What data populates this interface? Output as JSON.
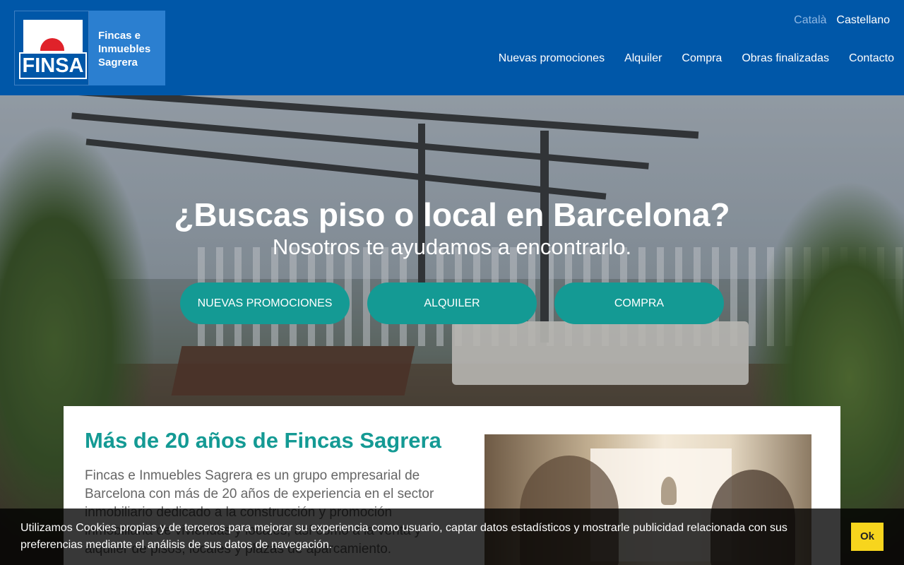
{
  "logo": {
    "mark_text": "FINSA",
    "name_lines": [
      "Fincas e",
      "Inmuebles",
      "Sagrera"
    ]
  },
  "languages": {
    "active": "Català",
    "other": "Castellano"
  },
  "nav": {
    "items": [
      "Nuevas promociones",
      "Alquiler",
      "Compra",
      "Obras finalizadas",
      "Contacto"
    ]
  },
  "hero": {
    "title": "¿Buscas piso o local en Barcelona?",
    "subtitle": "Nosotros te ayudamos a encontrarlo.",
    "buttons": [
      "NUEVAS PROMOCIONES",
      "ALQUILER",
      "COMPRA"
    ]
  },
  "intro": {
    "title": "Más de 20 años de Fincas Sagrera",
    "text": "Fincas e Inmuebles Sagrera es un grupo empresarial de Barcelona con más de 20 años de experiencia en el sector inmobiliario dedicado a la construcción y promoción inmobiliaria de viviendas y locales, así como a la venta y alquiler de pisos, locales y plazas de aparcamiento."
  },
  "cookie": {
    "text": "Utilizamos Cookies propias y de terceros para mejorar su experiencia como usuario, captar datos estadísticos y mostrarle publicidad relacionada con sus preferencias mediante el análisis de sus datos de navegación.",
    "ok_label": "Ok"
  },
  "colors": {
    "header_blue": "#0057a8",
    "teal": "#149a94",
    "cookie_ok": "#f7d51d"
  }
}
